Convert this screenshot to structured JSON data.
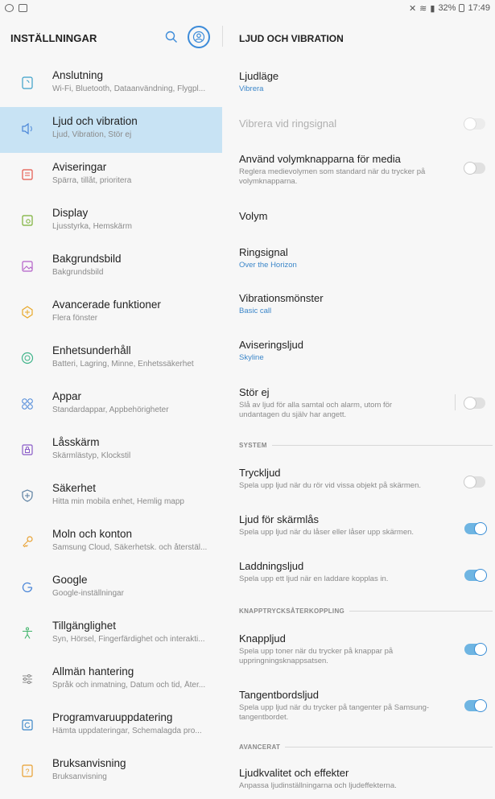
{
  "status": {
    "right_text": "32%",
    "time": "17:49"
  },
  "left": {
    "title": "INSTÄLLNINGAR",
    "items": [
      {
        "label": "Anslutning",
        "sub": "Wi-Fi, Bluetooth, Dataanvändning, Flygpl..."
      },
      {
        "label": "Ljud och vibration",
        "sub": "Ljud, Vibration, Stör ej"
      },
      {
        "label": "Aviseringar",
        "sub": "Spärra, tillåt, prioritera"
      },
      {
        "label": "Display",
        "sub": "Ljusstyrka, Hemskärm"
      },
      {
        "label": "Bakgrundsbild",
        "sub": "Bakgrundsbild"
      },
      {
        "label": "Avancerade funktioner",
        "sub": "Flera fönster"
      },
      {
        "label": "Enhetsunderhåll",
        "sub": "Batteri, Lagring, Minne, Enhetssäkerhet"
      },
      {
        "label": "Appar",
        "sub": "Standardappar, Appbehörigheter"
      },
      {
        "label": "Låsskärm",
        "sub": "Skärmlästyp, Klockstil"
      },
      {
        "label": "Säkerhet",
        "sub": "Hitta min mobila enhet, Hemlig mapp"
      },
      {
        "label": "Moln och konton",
        "sub": "Samsung Cloud, Säkerhetsk. och återstäl..."
      },
      {
        "label": "Google",
        "sub": "Google-inställningar"
      },
      {
        "label": "Tillgänglighet",
        "sub": "Syn, Hörsel, Fingerfärdighet och interakti..."
      },
      {
        "label": "Allmän hantering",
        "sub": "Språk och inmatning, Datum och tid, Åter..."
      },
      {
        "label": "Programvaruuppdatering",
        "sub": "Hämta uppdateringar, Schemalagda pro..."
      },
      {
        "label": "Bruksanvisning",
        "sub": "Bruksanvisning"
      }
    ]
  },
  "right": {
    "title": "LJUD OCH VIBRATION",
    "ljudlage": {
      "title": "Ljudläge",
      "value": "Vibrera"
    },
    "vibrera_ringsignal": {
      "title": "Vibrera vid ringsignal"
    },
    "volymknappar": {
      "title": "Använd volymknapparna för media",
      "sub": "Reglera medievolymen som standard när du trycker på volymknapparna."
    },
    "volym": {
      "title": "Volym"
    },
    "ringsignal": {
      "title": "Ringsignal",
      "value": "Over the Horizon"
    },
    "vibrationsmonster": {
      "title": "Vibrationsmönster",
      "value": "Basic call"
    },
    "aviseringsljud": {
      "title": "Aviseringsljud",
      "value": "Skyline"
    },
    "stor_ej": {
      "title": "Stör ej",
      "sub": "Slå av ljud för alla samtal och alarm, utom för undantagen du själv har angett."
    },
    "section_system": "SYSTEM",
    "tryckljud": {
      "title": "Tryckljud",
      "sub": "Spela upp ljud när du rör vid vissa objekt på skärmen."
    },
    "skarmlas": {
      "title": "Ljud för skärmlås",
      "sub": "Spela upp ljud när du låser eller låser upp skärmen."
    },
    "laddning": {
      "title": "Laddningsljud",
      "sub": "Spela upp ett ljud när en laddare kopplas in."
    },
    "section_knapp": "KNAPPTRYCKSÅTERKOPPLING",
    "knappljud": {
      "title": "Knappljud",
      "sub": "Spela upp toner när du trycker på knappar på uppringningsknappsatsen."
    },
    "tangentbord": {
      "title": "Tangentbordsljud",
      "sub": "Spela upp ljud när du trycker på tangenter på Samsung-tangentbordet."
    },
    "section_avancerat": "AVANCERAT",
    "ljudkvalitet": {
      "title": "Ljudkvalitet och effekter",
      "sub": "Anpassa ljudinställningarna och ljudeffekterna."
    }
  },
  "colors": {
    "accent": "#3b86c9",
    "selected_bg": "#c8e3f4",
    "toggle_on": "#6fb5e2"
  }
}
